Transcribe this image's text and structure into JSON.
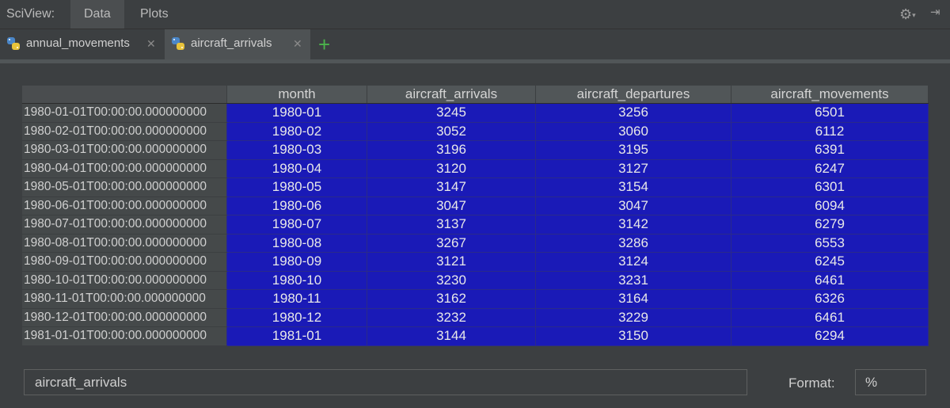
{
  "topbar": {
    "brand": "SciView:",
    "tabs": [
      "Data",
      "Plots"
    ]
  },
  "file_tabs": [
    {
      "label": "annual_movements",
      "active": false
    },
    {
      "label": "aircraft_arrivals",
      "active": true
    }
  ],
  "table": {
    "columns": [
      "month",
      "aircraft_arrivals",
      "aircraft_departures",
      "aircraft_movements"
    ],
    "rows": [
      {
        "index": "1980-01-01T00:00:00.000000000",
        "values": [
          "1980-01",
          "3245",
          "3256",
          "6501"
        ]
      },
      {
        "index": "1980-02-01T00:00:00.000000000",
        "values": [
          "1980-02",
          "3052",
          "3060",
          "6112"
        ]
      },
      {
        "index": "1980-03-01T00:00:00.000000000",
        "values": [
          "1980-03",
          "3196",
          "3195",
          "6391"
        ]
      },
      {
        "index": "1980-04-01T00:00:00.000000000",
        "values": [
          "1980-04",
          "3120",
          "3127",
          "6247"
        ]
      },
      {
        "index": "1980-05-01T00:00:00.000000000",
        "values": [
          "1980-05",
          "3147",
          "3154",
          "6301"
        ]
      },
      {
        "index": "1980-06-01T00:00:00.000000000",
        "values": [
          "1980-06",
          "3047",
          "3047",
          "6094"
        ]
      },
      {
        "index": "1980-07-01T00:00:00.000000000",
        "values": [
          "1980-07",
          "3137",
          "3142",
          "6279"
        ]
      },
      {
        "index": "1980-08-01T00:00:00.000000000",
        "values": [
          "1980-08",
          "3267",
          "3286",
          "6553"
        ]
      },
      {
        "index": "1980-09-01T00:00:00.000000000",
        "values": [
          "1980-09",
          "3121",
          "3124",
          "6245"
        ]
      },
      {
        "index": "1980-10-01T00:00:00.000000000",
        "values": [
          "1980-10",
          "3230",
          "3231",
          "6461"
        ]
      },
      {
        "index": "1980-11-01T00:00:00.000000000",
        "values": [
          "1980-11",
          "3162",
          "3164",
          "6326"
        ]
      },
      {
        "index": "1980-12-01T00:00:00.000000000",
        "values": [
          "1980-12",
          "3232",
          "3229",
          "6461"
        ]
      },
      {
        "index": "1981-01-01T00:00:00.000000000",
        "values": [
          "1981-01",
          "3144",
          "3150",
          "6294"
        ]
      }
    ]
  },
  "expression": "aircraft_arrivals",
  "format": {
    "label": "Format:",
    "value": "%"
  },
  "icons": {
    "settings": "gear-icon",
    "pin": "pin-icon",
    "close": "close-icon",
    "add": "plus-icon",
    "file": "python-icon"
  },
  "colors": {
    "cell_bg": "#1a1ab7",
    "add_icon": "#4bb34b",
    "background": "#3c3f41"
  }
}
